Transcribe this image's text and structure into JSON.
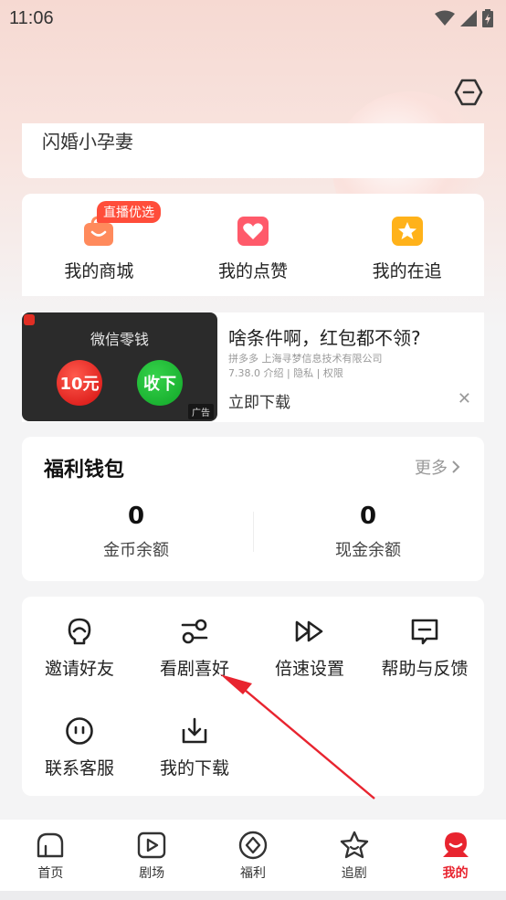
{
  "status_bar": {
    "time": "11:06"
  },
  "profile": {
    "title": "闪婚小孕妻"
  },
  "shortcuts": [
    {
      "label": "我的商城",
      "badge": "直播优选",
      "icon": "shop-bag-icon",
      "color": "#ff8a5c"
    },
    {
      "label": "我的点赞",
      "icon": "heart-icon",
      "color": "#ff5a6a"
    },
    {
      "label": "我的在追",
      "icon": "star-icon",
      "color": "#ffb21a"
    }
  ],
  "ad": {
    "image_title": "微信零钱",
    "coin_label": "10元",
    "take_label": "收下",
    "ad_tag": "广告",
    "headline": "啥条件啊，红包都不领?",
    "meta_line1": "拼多多   上海寻梦信息技术有限公司",
    "meta_line2": "7.38.0   介绍 | 隐私 | 权限",
    "cta": "立即下载",
    "close_symbol": "✕"
  },
  "wallet": {
    "title": "福利钱包",
    "more": "更多",
    "coins": {
      "value": "0",
      "label": "金币余额"
    },
    "cash": {
      "value": "0",
      "label": "现金余额"
    }
  },
  "tools": [
    {
      "label": "邀请好友",
      "icon": "invite-friend-icon"
    },
    {
      "label": "看剧喜好",
      "icon": "preference-sliders-icon"
    },
    {
      "label": "倍速设置",
      "icon": "fast-forward-icon"
    },
    {
      "label": "帮助与反馈",
      "icon": "feedback-message-icon"
    },
    {
      "label": "联系客服",
      "icon": "customer-service-icon"
    },
    {
      "label": "我的下载",
      "icon": "download-icon"
    }
  ],
  "tabs": [
    {
      "label": "首页",
      "icon": "home-icon",
      "active": false
    },
    {
      "label": "剧场",
      "icon": "theater-play-icon",
      "active": false
    },
    {
      "label": "福利",
      "icon": "welfare-icon",
      "active": false
    },
    {
      "label": "追剧",
      "icon": "follow-star-icon",
      "active": false
    },
    {
      "label": "我的",
      "icon": "profile-icon",
      "active": true
    }
  ],
  "colors": {
    "accent": "#e8242f",
    "ad_coin": "#e01414",
    "ad_take": "#1db534",
    "annotation_arrow": "#e8242f"
  }
}
